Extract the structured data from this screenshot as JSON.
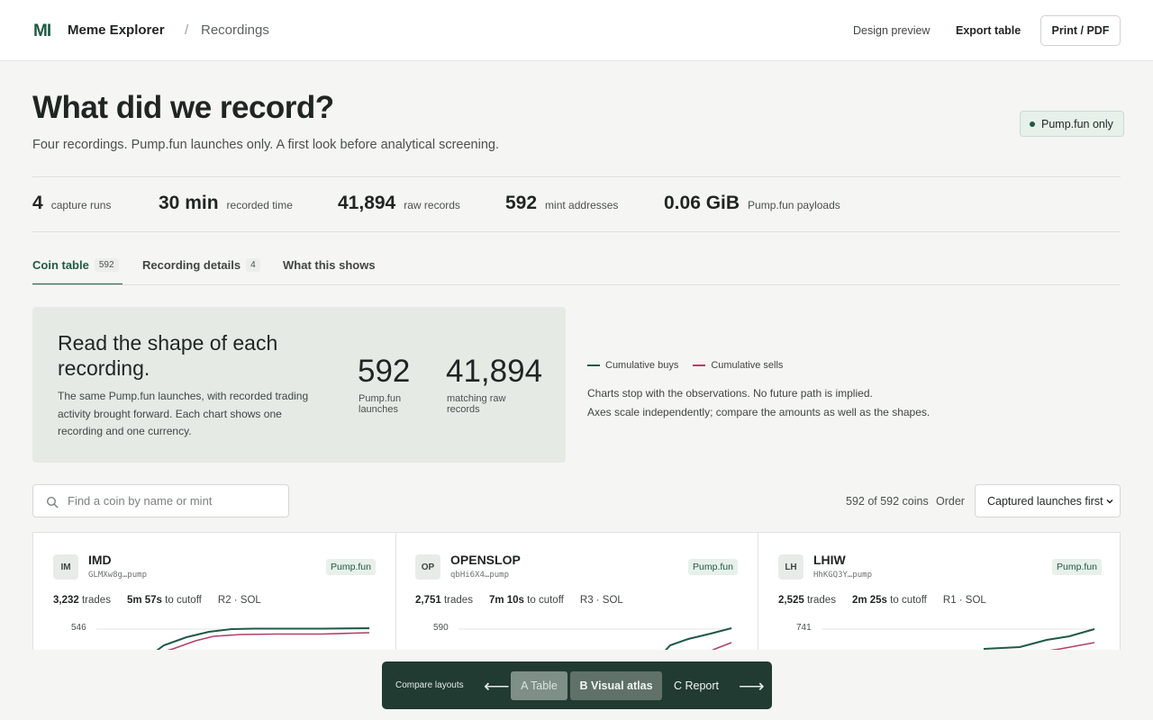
{
  "header": {
    "logo": "MI",
    "app_name": "Meme Explorer",
    "breadcrumb_sep": "/",
    "breadcrumb": "Recordings",
    "design_preview": "Design preview",
    "export_table": "Export table",
    "print_pdf": "Print / PDF"
  },
  "page": {
    "title": "What did we record?",
    "subtitle": "Four recordings. Pump.fun launches only. A first look before analytical screening.",
    "badge": "Pump.fun only"
  },
  "stats": [
    {
      "value": "4",
      "label": "capture runs"
    },
    {
      "value": "30 min",
      "label": "recorded time"
    },
    {
      "value": "41,894",
      "label": "raw records"
    },
    {
      "value": "592",
      "label": "mint addresses"
    },
    {
      "value": "0.06 GiB",
      "label": "Pump.fun payloads"
    }
  ],
  "tabs": [
    {
      "label": "Coin table",
      "count": "592"
    },
    {
      "label": "Recording details",
      "count": "4"
    },
    {
      "label": "What this shows",
      "count": ""
    }
  ],
  "hero": {
    "title": "Read the shape of each recording.",
    "description": "The same Pump.fun launches, with recorded trading activity brought forward. Each chart shows one recording and one currency.",
    "stat1_value": "592",
    "stat1_label": "Pump.fun launches",
    "stat2_value": "41,894",
    "stat2_label": "matching raw records"
  },
  "legend": {
    "buys": "Cumulative buys",
    "sells": "Cumulative sells",
    "buys_color": "#1f5a44",
    "sells_color": "#b0416a"
  },
  "notes": [
    "Charts stop with the observations. No future path is implied.",
    "Axes scale independently; compare the amounts as well as the shapes."
  ],
  "search": {
    "placeholder": "Find a coin by name or mint"
  },
  "results": {
    "count_text": "592 of 592 coins",
    "order_label": "Order",
    "order_value": "Captured launches first"
  },
  "cards": [
    {
      "initials": "IM",
      "name": "IMD",
      "mint": "GLMXw8g…pump",
      "platform": "Pump.fun",
      "trades": "3,232",
      "trades_label": "trades",
      "cutoff": "5m 57s",
      "cutoff_label": "to cutoff",
      "run": "R2 · SOL",
      "ytick": "546"
    },
    {
      "initials": "OP",
      "name": "OPENSLOP",
      "mint": "qbHi6X4…pump",
      "platform": "Pump.fun",
      "trades": "2,751",
      "trades_label": "trades",
      "cutoff": "7m 10s",
      "cutoff_label": "to cutoff",
      "run": "R3 · SOL",
      "ytick": "590"
    },
    {
      "initials": "LH",
      "name": "LHIW",
      "mint": "HhKGQ3Y…pump",
      "platform": "Pump.fun",
      "trades": "2,525",
      "trades_label": "trades",
      "cutoff": "2m 25s",
      "cutoff_label": "to cutoff",
      "run": "R1 · SOL",
      "ytick": "741"
    }
  ],
  "compare": {
    "label": "Compare layouts",
    "prev": "⟵",
    "a": "A Table",
    "b": "B Visual atlas",
    "c": "C Report",
    "next": "⟶"
  }
}
